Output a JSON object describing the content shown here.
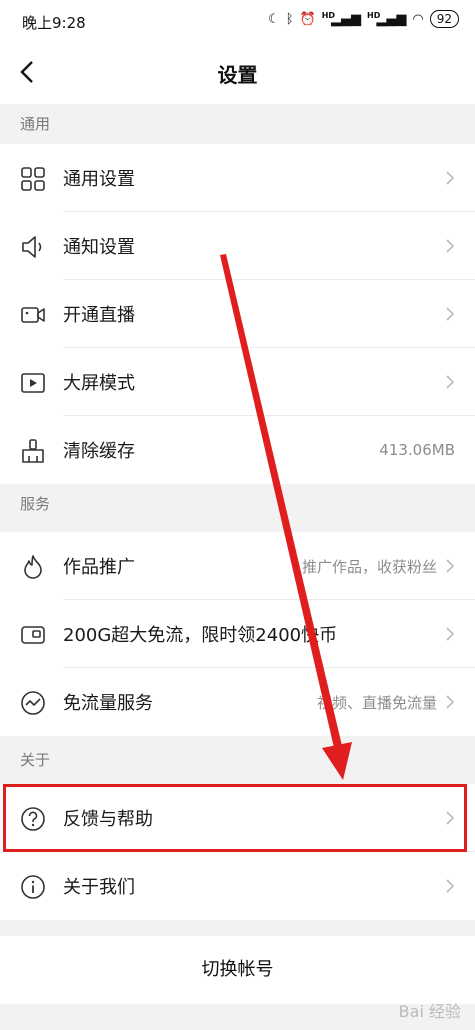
{
  "status_bar": {
    "time": "晚上9:28",
    "battery": "92"
  },
  "header": {
    "title": "设置"
  },
  "sections": [
    {
      "title": "通用",
      "items": [
        {
          "label": "通用设置",
          "icon": "grid-icon"
        },
        {
          "label": "通知设置",
          "icon": "speaker-icon"
        },
        {
          "label": "开通直播",
          "icon": "video-camera-icon"
        },
        {
          "label": "大屏模式",
          "icon": "play-screen-icon"
        },
        {
          "label": "清除缓存",
          "icon": "broom-icon",
          "value": "413.06MB"
        }
      ]
    },
    {
      "title": "服务",
      "items": [
        {
          "label": "作品推广",
          "icon": "flame-icon",
          "value": "推广作品，收获粉丝"
        },
        {
          "label": "200G超大免流，限时领2400快币",
          "icon": "card-icon"
        },
        {
          "label": "免流量服务",
          "icon": "trend-circle-icon",
          "value": "视频、直播免流量"
        }
      ]
    },
    {
      "title": "关于",
      "items": [
        {
          "label": "反馈与帮助",
          "icon": "question-circle-icon"
        },
        {
          "label": "关于我们",
          "icon": "info-circle-icon"
        }
      ]
    }
  ],
  "switch_account": "切换帐号",
  "watermark": "Bai 经验",
  "colors": {
    "highlight": "#e01e1e",
    "arrow": "#e01e1e"
  }
}
